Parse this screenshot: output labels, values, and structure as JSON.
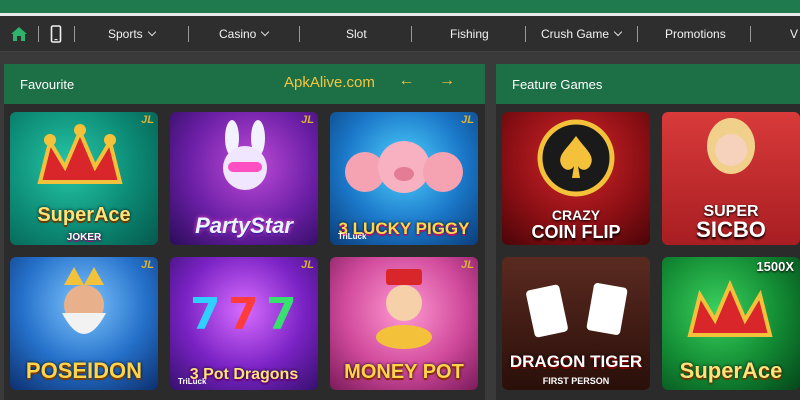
{
  "nav": {
    "items": [
      {
        "label": "Sports",
        "dropdown": true
      },
      {
        "label": "Casino",
        "dropdown": true
      },
      {
        "label": "Slot",
        "dropdown": false
      },
      {
        "label": "Fishing",
        "dropdown": false
      },
      {
        "label": "Crush Game",
        "dropdown": true
      },
      {
        "label": "Promotions",
        "dropdown": false
      },
      {
        "label": "V",
        "dropdown": false
      }
    ]
  },
  "favourite": {
    "title": "Favourite",
    "watermark": "ApkAlive.com",
    "arrows": "← →",
    "games": [
      {
        "title": "SuperAce",
        "subtitle": "JOKER",
        "badge": "JL"
      },
      {
        "title": "PartyStar",
        "subtitle": "",
        "badge": "JL"
      },
      {
        "title": "3 LUCKY PIGGY",
        "subtitle": "TriLuck",
        "badge": "JL"
      },
      {
        "title": "POSEIDON",
        "subtitle": "",
        "badge": "JL"
      },
      {
        "title": "3 Pot Dragons",
        "subtitle": "TriLuck",
        "badge": "JL"
      },
      {
        "title": "MONEY POT",
        "subtitle": "",
        "badge": "JL"
      }
    ]
  },
  "feature": {
    "title": "Feature Games",
    "games": [
      {
        "title": "COIN FLIP",
        "subtitle": "CRAZY",
        "badge": ""
      },
      {
        "title": "SICBO",
        "subtitle": "SUPER",
        "badge": ""
      },
      {
        "title": "DRAGON TIGER",
        "subtitle": "FIRST PERSON",
        "badge": ""
      },
      {
        "title": "SuperAce",
        "subtitle": "1500X",
        "badge": ""
      }
    ]
  },
  "colors": {
    "brand_green": "#1d6f45",
    "accent_gold": "#f5c542",
    "nav_bg": "#2e2e2e"
  }
}
